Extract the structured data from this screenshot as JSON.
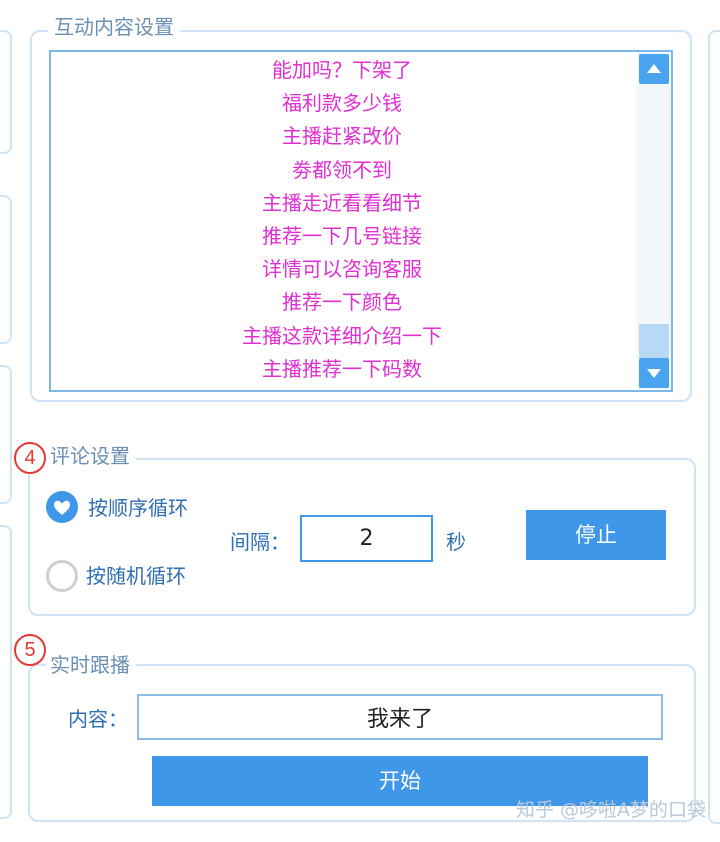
{
  "interaction_content": {
    "legend": "互动内容设置",
    "items": [
      "能加吗？下架了",
      "福利款多少钱",
      "主播赶紧改价",
      "劵都领不到",
      "主播走近看看细节",
      "推荐一下几号链接",
      "详情可以咨询客服",
      "推荐一下颜色",
      "主播这款详细介绍一下",
      "主播推荐一下码数"
    ]
  },
  "comment_settings": {
    "step_number": "4",
    "legend": "评论设置",
    "options": [
      {
        "label": "按顺序循环",
        "selected": true
      },
      {
        "label": "按随机循环",
        "selected": false
      }
    ],
    "interval_label": "间隔：",
    "interval_value": "2",
    "interval_unit": "秒",
    "stop_button": "停止"
  },
  "live_follow": {
    "step_number": "5",
    "legend": "实时跟播",
    "content_label": "内容：",
    "content_value": "我来了",
    "start_button": "开始"
  },
  "watermark": "知乎 @哆啦A梦的口袋",
  "colors": {
    "accent": "#3f97ea",
    "list_text": "#e02fd2",
    "step_marker": "#e53935",
    "panel_border": "#cfe3f6"
  }
}
